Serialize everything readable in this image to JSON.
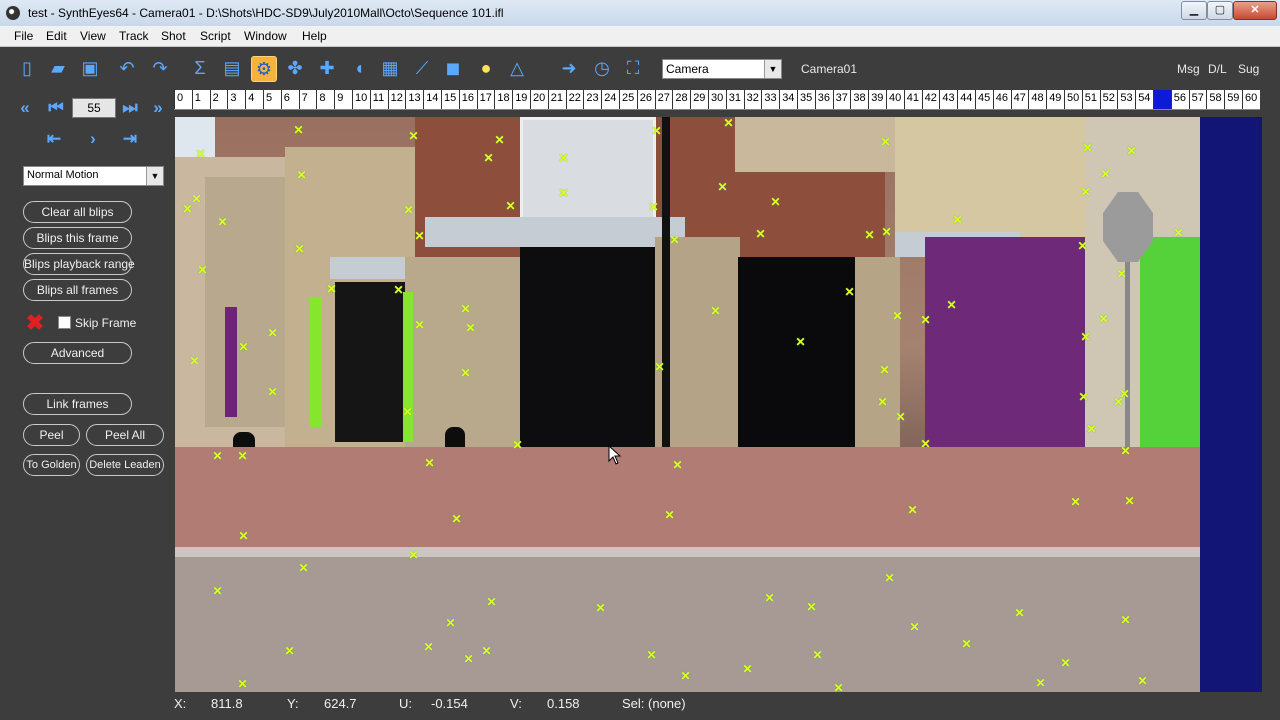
{
  "window": {
    "title": "test - SynthEyes64 - Camera01 - D:\\Shots\\HDC-SD9\\July2010Mall\\Octo\\Sequence 101.ifl"
  },
  "menu": [
    "File",
    "Edit",
    "View",
    "Track",
    "Shot",
    "Script",
    "Window",
    "Help"
  ],
  "toolbar": {
    "camera_select": "Camera",
    "camera_name": "Camera01",
    "right_tabs": [
      "Msg",
      "D/L",
      "Sug"
    ]
  },
  "frame_nav": {
    "current_frame": "55"
  },
  "ruler": {
    "ticks": [
      "0",
      "1",
      "2",
      "3",
      "4",
      "5",
      "6",
      "7",
      "8",
      "9",
      "10",
      "11",
      "12",
      "13",
      "14",
      "15",
      "16",
      "17",
      "18",
      "19",
      "20",
      "21",
      "22",
      "23",
      "24",
      "25",
      "26",
      "27",
      "28",
      "29",
      "30",
      "31",
      "32",
      "33",
      "34",
      "35",
      "36",
      "37",
      "38",
      "39",
      "40",
      "41",
      "42",
      "43",
      "44",
      "45",
      "46",
      "47",
      "48",
      "49",
      "50",
      "51",
      "52",
      "53",
      "54",
      "55",
      "56",
      "57",
      "58",
      "59",
      "60"
    ],
    "current": "55"
  },
  "panel": {
    "motion_select": "Normal Motion",
    "buttons": {
      "clear_all_blips": "Clear all blips",
      "blips_this_frame": "Blips this frame",
      "blips_playback_range": "Blips playback range",
      "blips_all_frames": "Blips all frames",
      "advanced": "Advanced",
      "link_frames": "Link frames",
      "peel": "Peel",
      "peel_all": "Peel All",
      "to_golden": "To Golden",
      "delete_leaden": "Delete Leaden"
    },
    "skip_frame": "Skip Frame"
  },
  "status": {
    "x_label": "X:",
    "x_value": "811.8",
    "y_label": "Y:",
    "y_value": "624.7",
    "u_label": "U:",
    "u_value": "-0.154",
    "v_label": "V:",
    "v_value": "0.158",
    "sel_label": "Sel: (none)"
  },
  "colors": {
    "tracker": "#e5ff1a",
    "accent": "#5aa8ff",
    "current_frame": "#0b1bd6"
  }
}
